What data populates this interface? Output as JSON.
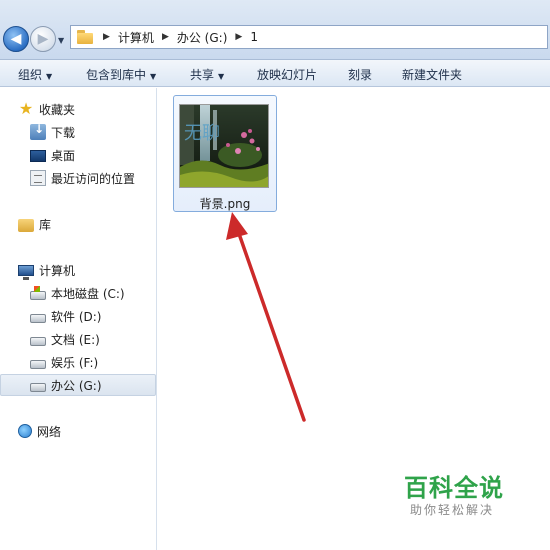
{
  "address": {
    "breadcrumbs": [
      "计算机",
      "办公 (G:)",
      "1"
    ]
  },
  "toolbar": {
    "organize": "组织",
    "include_library": "包含到库中",
    "share": "共享",
    "slideshow": "放映幻灯片",
    "burn": "刻录",
    "new_folder": "新建文件夹"
  },
  "sidebar": {
    "favorites": "收藏夹",
    "downloads": "下载",
    "desktop": "桌面",
    "recent": "最近访问的位置",
    "libraries": "库",
    "computer": "计算机",
    "drives": [
      "本地磁盘 (C:)",
      "软件 (D:)",
      "文档 (E:)",
      "娱乐 (F:)",
      "办公 (G:)"
    ],
    "network": "网络"
  },
  "files": [
    {
      "name": "背景.png",
      "thumb_text": "无聊"
    }
  ],
  "watermark": {
    "title": "百科全说",
    "subtitle": "助你轻松解决"
  },
  "colors": {
    "annotation_arrow": "#cc2a2a",
    "watermark_green": "#2fa34a"
  }
}
